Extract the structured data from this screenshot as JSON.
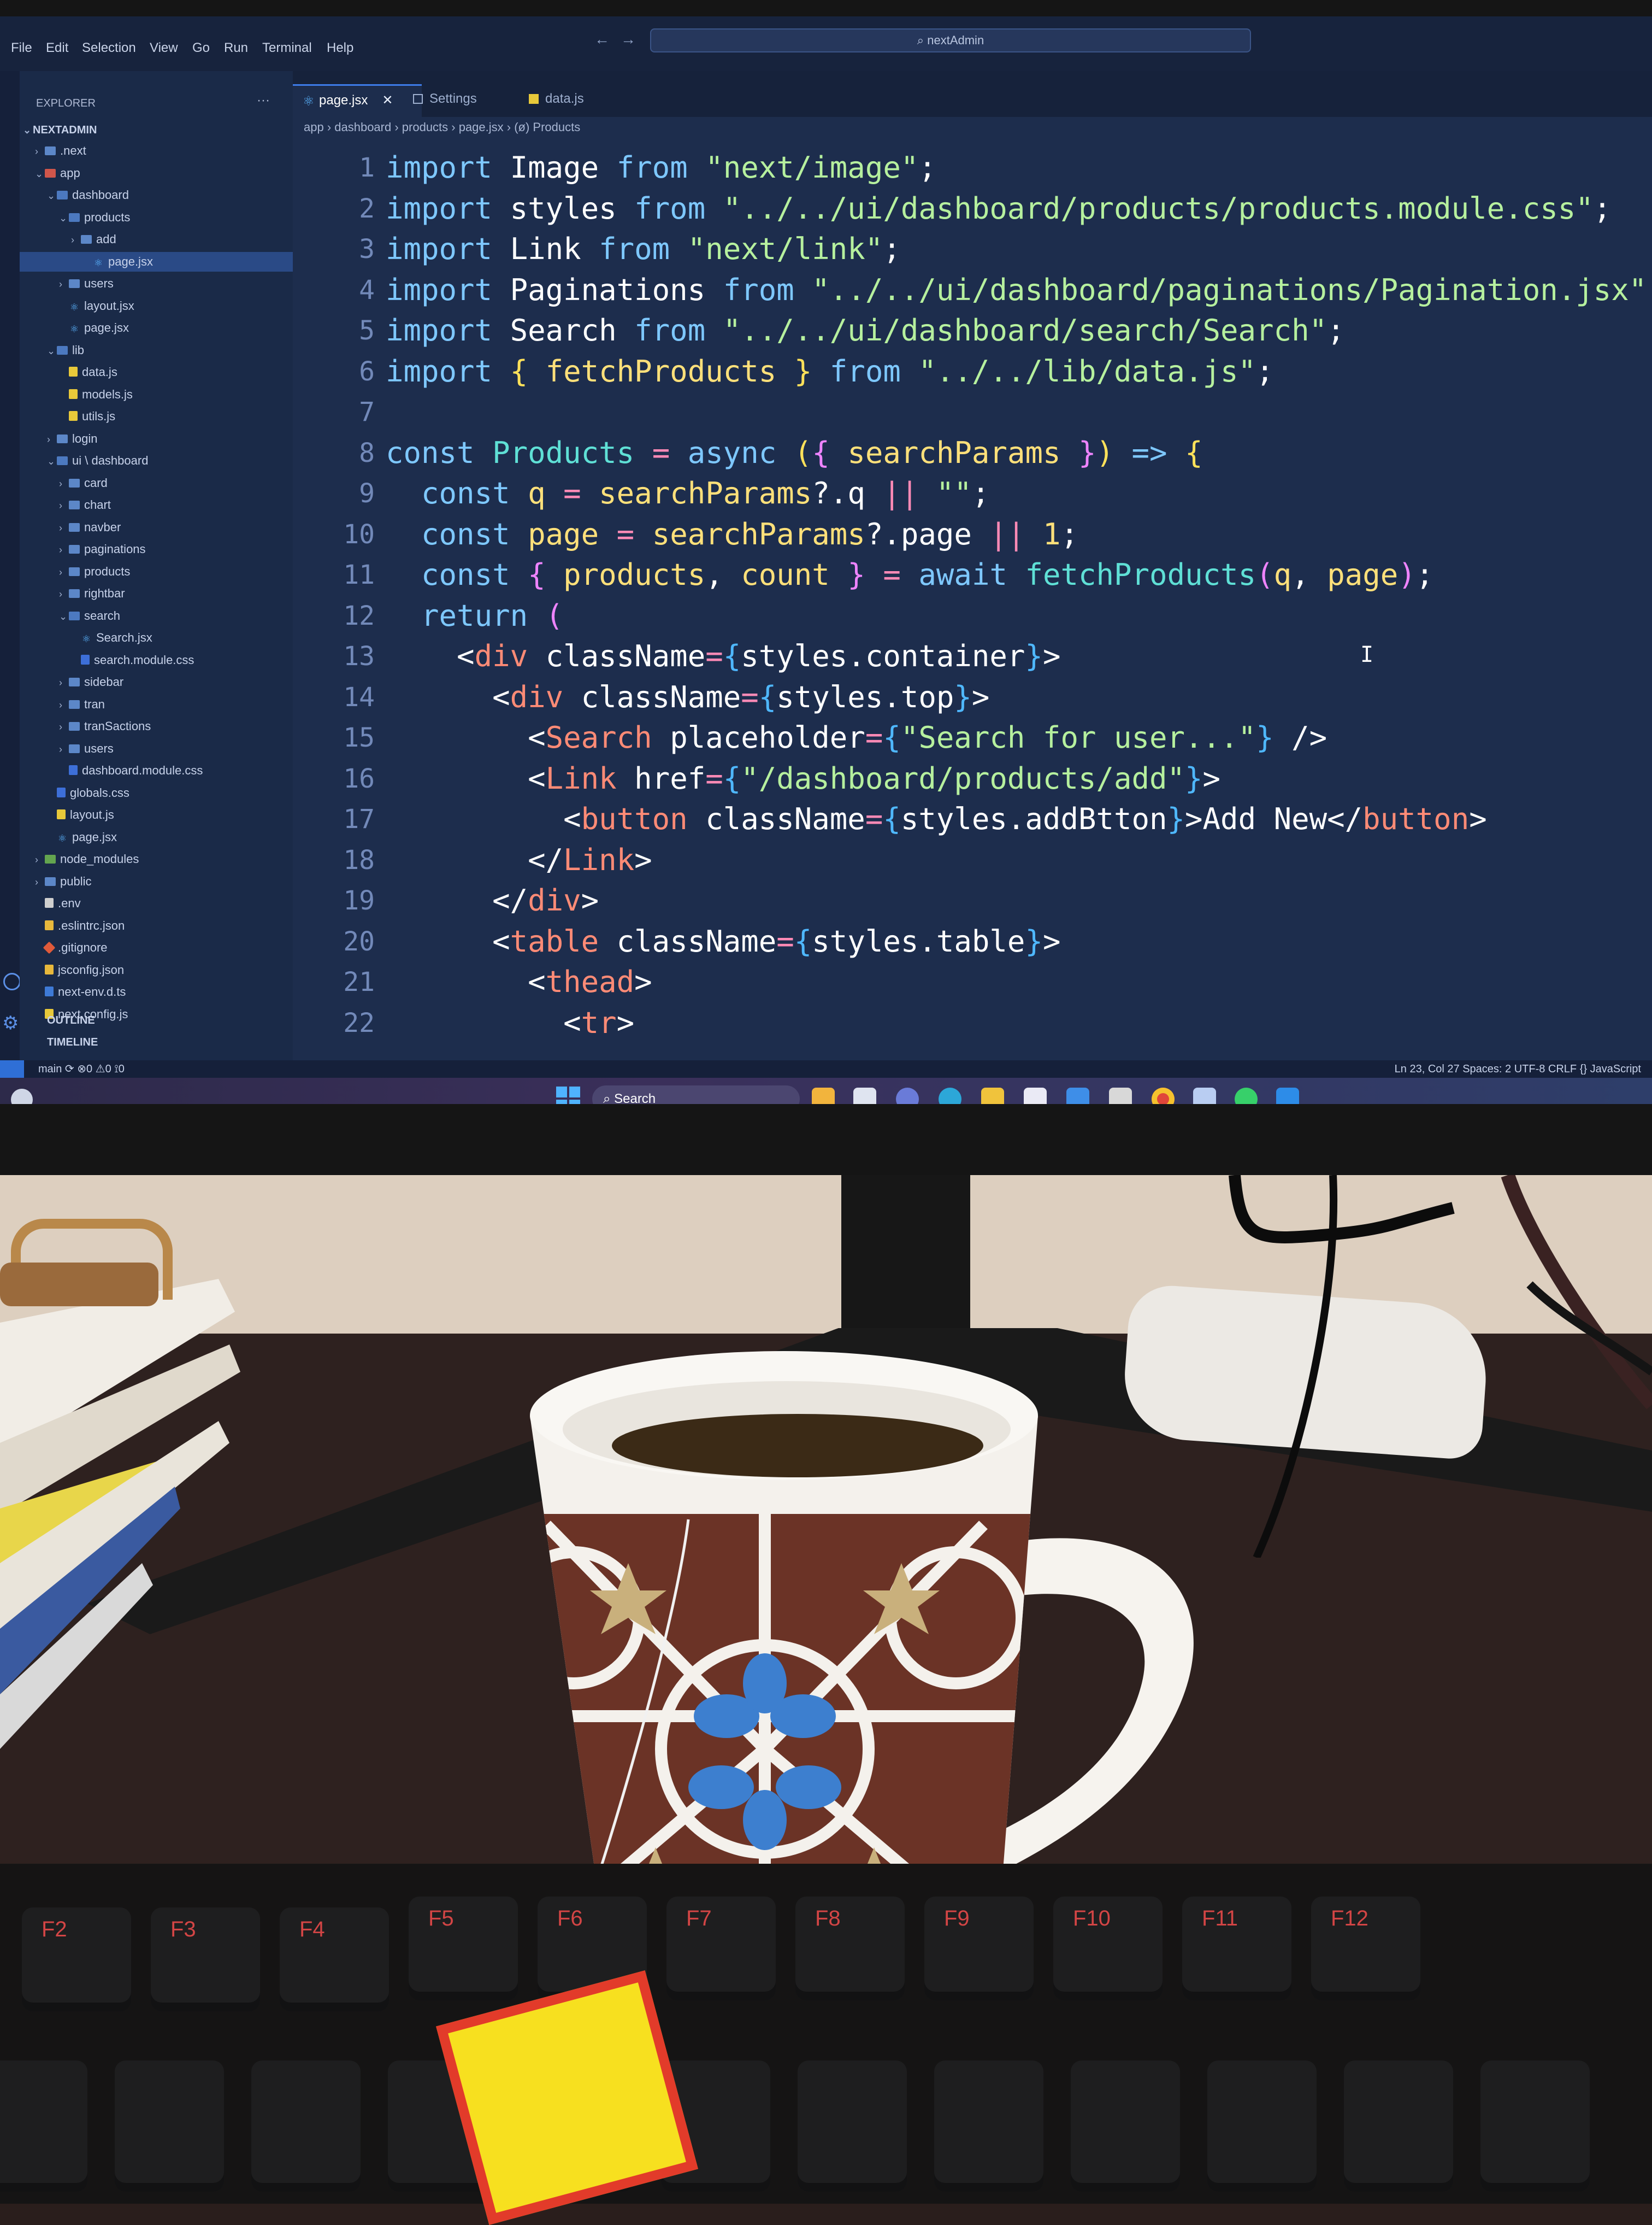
{
  "editor_app": {
    "menu": [
      "File",
      "Edit",
      "Selection",
      "View",
      "Go",
      "Run",
      "Terminal",
      "Help"
    ],
    "command_center": "nextAdmin",
    "explorer": {
      "title": "EXPLORER",
      "root": "NEXTADMIN",
      "tree": [
        {
          "label": ".next",
          "depth": 1,
          "kind": "folder",
          "chev": "›"
        },
        {
          "label": "app",
          "depth": 1,
          "kind": "folder-red",
          "chev": "⌄"
        },
        {
          "label": "dashboard",
          "depth": 2,
          "kind": "folder-open",
          "chev": "⌄"
        },
        {
          "label": "products",
          "depth": 3,
          "kind": "folder-open",
          "chev": "⌄"
        },
        {
          "label": "add",
          "depth": 4,
          "kind": "folder",
          "chev": "›"
        },
        {
          "label": "page.jsx",
          "depth": 5,
          "kind": "jsx",
          "active": true
        },
        {
          "label": "users",
          "depth": 3,
          "kind": "folder",
          "chev": "›"
        },
        {
          "label": "layout.jsx",
          "depth": 3,
          "kind": "jsx"
        },
        {
          "label": "page.jsx",
          "depth": 3,
          "kind": "jsx"
        },
        {
          "label": "lib",
          "depth": 2,
          "kind": "folder-open",
          "chev": "⌄"
        },
        {
          "label": "data.js",
          "depth": 3,
          "kind": "js"
        },
        {
          "label": "models.js",
          "depth": 3,
          "kind": "js"
        },
        {
          "label": "utils.js",
          "depth": 3,
          "kind": "js"
        },
        {
          "label": "login",
          "depth": 2,
          "kind": "folder",
          "chev": "›"
        },
        {
          "label": "ui \\ dashboard",
          "depth": 2,
          "kind": "folder-open",
          "chev": "⌄"
        },
        {
          "label": "card",
          "depth": 3,
          "kind": "folder",
          "chev": "›"
        },
        {
          "label": "chart",
          "depth": 3,
          "kind": "folder",
          "chev": "›"
        },
        {
          "label": "navber",
          "depth": 3,
          "kind": "folder",
          "chev": "›"
        },
        {
          "label": "paginations",
          "depth": 3,
          "kind": "folder",
          "chev": "›"
        },
        {
          "label": "products",
          "depth": 3,
          "kind": "folder",
          "chev": "›"
        },
        {
          "label": "rightbar",
          "depth": 3,
          "kind": "folder",
          "chev": "›"
        },
        {
          "label": "search",
          "depth": 3,
          "kind": "folder-open",
          "chev": "⌄"
        },
        {
          "label": "Search.jsx",
          "depth": 4,
          "kind": "jsx"
        },
        {
          "label": "search.module.css",
          "depth": 4,
          "kind": "css"
        },
        {
          "label": "sidebar",
          "depth": 3,
          "kind": "folder",
          "chev": "›"
        },
        {
          "label": "tran",
          "depth": 3,
          "kind": "folder",
          "chev": "›"
        },
        {
          "label": "tranSactions",
          "depth": 3,
          "kind": "folder",
          "chev": "›"
        },
        {
          "label": "users",
          "depth": 3,
          "kind": "folder",
          "chev": "›"
        },
        {
          "label": "dashboard.module.css",
          "depth": 3,
          "kind": "css"
        },
        {
          "label": "globals.css",
          "depth": 2,
          "kind": "css"
        },
        {
          "label": "layout.js",
          "depth": 2,
          "kind": "js"
        },
        {
          "label": "page.jsx",
          "depth": 2,
          "kind": "jsx"
        },
        {
          "label": "node_modules",
          "depth": 1,
          "kind": "folder-green",
          "chev": "›"
        },
        {
          "label": "public",
          "depth": 1,
          "kind": "folder",
          "chev": "›"
        },
        {
          "label": ".env",
          "depth": 1,
          "kind": "env"
        },
        {
          "label": ".eslintrc.json",
          "depth": 1,
          "kind": "json"
        },
        {
          "label": ".gitignore",
          "depth": 1,
          "kind": "git"
        },
        {
          "label": "jsconfig.json",
          "depth": 1,
          "kind": "json"
        },
        {
          "label": "next-env.d.ts",
          "depth": 1,
          "kind": "ts"
        },
        {
          "label": "next.config.js",
          "depth": 1,
          "kind": "js"
        }
      ],
      "outline": "OUTLINE",
      "timeline": "TIMELINE"
    },
    "tabs": [
      {
        "label": "page.jsx",
        "active": true
      },
      {
        "label": "Settings",
        "active": false
      },
      {
        "label": "data.js",
        "active": false
      }
    ],
    "breadcrumb": "app › dashboard › products › page.jsx › (ø) Products",
    "code": [
      [
        [
          "kw",
          "import "
        ],
        [
          "imp",
          "Image "
        ],
        [
          "kw",
          "from "
        ],
        [
          "str",
          "\"next/image\""
        ],
        [
          "punc",
          ";"
        ]
      ],
      [
        [
          "kw",
          "import "
        ],
        [
          "imp",
          "styles "
        ],
        [
          "kw",
          "from "
        ],
        [
          "str",
          "\"../../ui/dashboard/products/products.module.css\""
        ],
        [
          "punc",
          ";"
        ]
      ],
      [
        [
          "kw",
          "import "
        ],
        [
          "imp",
          "Link "
        ],
        [
          "kw",
          "from "
        ],
        [
          "str",
          "\"next/link\""
        ],
        [
          "punc",
          ";"
        ]
      ],
      [
        [
          "kw",
          "import "
        ],
        [
          "imp",
          "Paginations "
        ],
        [
          "kw",
          "from "
        ],
        [
          "str",
          "\"../../ui/dashboard/paginations/Pagination.jsx\""
        ],
        [
          "punc",
          ";"
        ]
      ],
      [
        [
          "kw",
          "import "
        ],
        [
          "imp",
          "Search "
        ],
        [
          "kw",
          "from "
        ],
        [
          "str",
          "\"../../ui/dashboard/search/Search\""
        ],
        [
          "punc",
          ";"
        ]
      ],
      [
        [
          "kw",
          "import "
        ],
        [
          "br1",
          "{ "
        ],
        [
          "var",
          "fetchProducts "
        ],
        [
          "br1",
          "} "
        ],
        [
          "kw",
          "from "
        ],
        [
          "str",
          "\"../../lib/data.js\""
        ],
        [
          "punc",
          ";"
        ]
      ],
      [],
      [
        [
          "kw",
          "const "
        ],
        [
          "fn",
          "Products "
        ],
        [
          "op",
          "= "
        ],
        [
          "kw",
          "async "
        ],
        [
          "br1",
          "("
        ],
        [
          "br2",
          "{ "
        ],
        [
          "var",
          "searchParams "
        ],
        [
          "br2",
          "}"
        ],
        [
          "br1",
          ") "
        ],
        [
          "kw",
          "=> "
        ],
        [
          "br1",
          "{"
        ]
      ],
      [
        [
          "punc",
          "  "
        ],
        [
          "kw",
          "const "
        ],
        [
          "var",
          "q "
        ],
        [
          "op",
          "= "
        ],
        [
          "var",
          "searchParams"
        ],
        [
          "punc",
          "?.q "
        ],
        [
          "op",
          "|| "
        ],
        [
          "str",
          "\"\""
        ],
        [
          "punc",
          ";"
        ]
      ],
      [
        [
          "punc",
          "  "
        ],
        [
          "kw",
          "const "
        ],
        [
          "var",
          "page "
        ],
        [
          "op",
          "= "
        ],
        [
          "var",
          "searchParams"
        ],
        [
          "punc",
          "?.page "
        ],
        [
          "op",
          "|| "
        ],
        [
          "num",
          "1"
        ],
        [
          "punc",
          ";"
        ]
      ],
      [
        [
          "punc",
          "  "
        ],
        [
          "kw",
          "const "
        ],
        [
          "br2",
          "{ "
        ],
        [
          "var",
          "products"
        ],
        [
          "punc",
          ", "
        ],
        [
          "var",
          "count "
        ],
        [
          "br2",
          "} "
        ],
        [
          "op",
          "= "
        ],
        [
          "kw",
          "await "
        ],
        [
          "fn",
          "fetchProducts"
        ],
        [
          "br2",
          "("
        ],
        [
          "var",
          "q"
        ],
        [
          "punc",
          ", "
        ],
        [
          "var",
          "page"
        ],
        [
          "br2",
          ")"
        ],
        [
          "punc",
          ";"
        ]
      ],
      [
        [
          "punc",
          "  "
        ],
        [
          "kw",
          "return "
        ],
        [
          "br2",
          "("
        ]
      ],
      [
        [
          "punc",
          "    <"
        ],
        [
          "tag",
          "div "
        ],
        [
          "attr",
          "className"
        ],
        [
          "op",
          "="
        ],
        [
          "br3",
          "{"
        ],
        [
          "name",
          "styles.container"
        ],
        [
          "br3",
          "}"
        ],
        [
          "punc",
          ">"
        ]
      ],
      [
        [
          "punc",
          "      <"
        ],
        [
          "tag",
          "div "
        ],
        [
          "attr",
          "className"
        ],
        [
          "op",
          "="
        ],
        [
          "br3",
          "{"
        ],
        [
          "name",
          "styles.top"
        ],
        [
          "br3",
          "}"
        ],
        [
          "punc",
          ">"
        ]
      ],
      [
        [
          "punc",
          "        <"
        ],
        [
          "tag",
          "Search "
        ],
        [
          "attr",
          "placeholder"
        ],
        [
          "op",
          "="
        ],
        [
          "br3",
          "{"
        ],
        [
          "str",
          "\"Search for user...\""
        ],
        [
          "br3",
          "} "
        ],
        [
          "punc",
          "/>"
        ]
      ],
      [
        [
          "punc",
          "        <"
        ],
        [
          "tag",
          "Link "
        ],
        [
          "attr",
          "href"
        ],
        [
          "op",
          "="
        ],
        [
          "br3",
          "{"
        ],
        [
          "str",
          "\"/dashboard/products/add\""
        ],
        [
          "br3",
          "}"
        ],
        [
          "punc",
          ">"
        ]
      ],
      [
        [
          "punc",
          "          <"
        ],
        [
          "tag",
          "button "
        ],
        [
          "attr",
          "className"
        ],
        [
          "op",
          "="
        ],
        [
          "br3",
          "{"
        ],
        [
          "name",
          "styles.addBtton"
        ],
        [
          "br3",
          "}"
        ],
        [
          "punc",
          ">Add New</"
        ],
        [
          "tag",
          "button"
        ],
        [
          "punc",
          ">"
        ]
      ],
      [
        [
          "punc",
          "        </"
        ],
        [
          "tag",
          "Link"
        ],
        [
          "punc",
          ">"
        ]
      ],
      [
        [
          "punc",
          "      </"
        ],
        [
          "tag",
          "div"
        ],
        [
          "punc",
          ">"
        ]
      ],
      [
        [
          "punc",
          "      <"
        ],
        [
          "tag",
          "table "
        ],
        [
          "attr",
          "className"
        ],
        [
          "op",
          "="
        ],
        [
          "br3",
          "{"
        ],
        [
          "name",
          "styles.table"
        ],
        [
          "br3",
          "}"
        ],
        [
          "punc",
          ">"
        ]
      ],
      [
        [
          "punc",
          "        <"
        ],
        [
          "tag",
          "thead"
        ],
        [
          "punc",
          ">"
        ]
      ],
      [
        [
          "punc",
          "          <"
        ],
        [
          "tag",
          "tr"
        ],
        [
          "punc",
          ">"
        ]
      ]
    ],
    "statusbar": {
      "left": "main ⟳  ⊗0 ⚠0  ⟟0",
      "right": "Ln 23, Col 27   Spaces: 2   UTF-8   CRLF   {} JavaScript"
    },
    "taskbar": {
      "search": "Search"
    }
  },
  "scene": {
    "keyboard_keys": [
      "F2",
      "F3",
      "F4",
      "F5",
      "F6",
      "F7",
      "F8",
      "F9",
      "F10",
      "F11",
      "F12"
    ]
  }
}
